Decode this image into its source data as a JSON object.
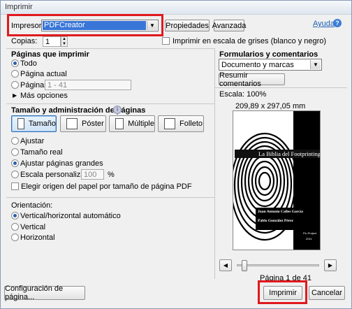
{
  "window": {
    "title": "Imprimir"
  },
  "printer": {
    "label": "Impresora:",
    "value": "PDFCreator",
    "properties_label": "Propiedades",
    "advanced_label": "Avanzada",
    "help_label": "Ayuda"
  },
  "copies": {
    "label": "Copias:",
    "value": "1",
    "grayscale_label": "Imprimir en escala de grises (blanco y negro)"
  },
  "pages": {
    "title": "Páginas que imprimir",
    "all_label": "Todo",
    "current_label": "Página actual",
    "pages_label": "Páginas",
    "pages_placeholder": "1 - 41",
    "more_options_label": "Más opciones"
  },
  "sizing": {
    "title": "Tamaño y administración de páginas",
    "tabs": [
      "Tamaño",
      "Póster",
      "Múltiple",
      "Folleto"
    ],
    "fit_label": "Ajustar",
    "actual_label": "Tamaño real",
    "shrink_label": "Ajustar páginas grandes",
    "custom_label": "Escala personalizada:",
    "custom_value": "100",
    "percent": "%",
    "paper_source_label": "Elegir origen del papel por tamaño de página PDF"
  },
  "orientation": {
    "title": "Orientación:",
    "auto_label": "Vertical/horizontal automático",
    "portrait_label": "Vertical",
    "landscape_label": "Horizontal"
  },
  "comments": {
    "title": "Formularios y comentarios",
    "value": "Documento y marcas",
    "summarize_label": "Resumir comentarios"
  },
  "preview": {
    "scale": "Escala: 100%",
    "dimensions": "209,89 x 297,05 mm",
    "doc_title": "La Biblia del Footprinting",
    "author1": "Juan Antonio Calles García",
    "author2": "Pablo González Pérez",
    "publisher": "Flu Project",
    "year": "2011",
    "page_status": "Página 1 de 41",
    "slider_position": 0.05
  },
  "footer": {
    "page_setup_label": "Configuración de página...",
    "print_label": "Imprimir",
    "cancel_label": "Cancelar"
  }
}
